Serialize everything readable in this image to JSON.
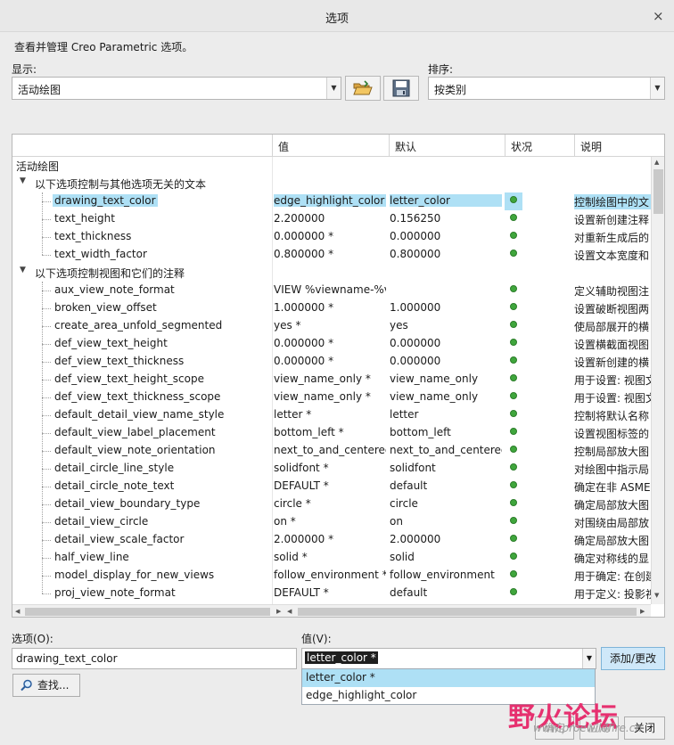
{
  "window": {
    "title": "选项",
    "close": "×"
  },
  "description": "查看并管理 Creo Parametric 选项。",
  "display": {
    "label": "显示:",
    "value": "活动绘图"
  },
  "sort": {
    "label": "排序:",
    "value": "按类别"
  },
  "columns": [
    "值",
    "默认",
    "状况",
    "说明"
  ],
  "tree": {
    "root": "活动绘图",
    "groups": [
      {
        "label": "以下选项控制与其他选项无关的文本",
        "rows": [
          {
            "name": "drawing_text_color",
            "value": "edge_highlight_color",
            "default": "letter_color",
            "desc": "控制绘图中的文"
          },
          {
            "name": "text_height",
            "value": "2.200000",
            "default": "0.156250",
            "desc": "设置新创建注释"
          },
          {
            "name": "text_thickness",
            "value": "0.000000 *",
            "default": "0.000000",
            "desc": "对重新生成后的"
          },
          {
            "name": "text_width_factor",
            "value": "0.800000 *",
            "default": "0.800000",
            "desc": "设置文本宽度和"
          }
        ]
      },
      {
        "label": "以下选项控制视图和它们的注释",
        "rows": [
          {
            "name": "aux_view_note_format",
            "value": "VIEW %viewname-%vi",
            "default": "",
            "desc": "定义辅助视图注"
          },
          {
            "name": "broken_view_offset",
            "value": "1.000000 *",
            "default": "1.000000",
            "desc": "设置破断视图两"
          },
          {
            "name": "create_area_unfold_segmented",
            "value": "yes *",
            "default": "yes",
            "desc": "使局部展开的横"
          },
          {
            "name": "def_view_text_height",
            "value": "0.000000 *",
            "default": "0.000000",
            "desc": "设置横截面视图"
          },
          {
            "name": "def_view_text_thickness",
            "value": "0.000000 *",
            "default": "0.000000",
            "desc": "设置新创建的横"
          },
          {
            "name": "def_view_text_height_scope",
            "value": "view_name_only *",
            "default": "view_name_only",
            "desc": "用于设置: 视图文"
          },
          {
            "name": "def_view_text_thickness_scope",
            "value": "view_name_only *",
            "default": "view_name_only",
            "desc": "用于设置: 视图文"
          },
          {
            "name": "default_detail_view_name_style",
            "value": "letter *",
            "default": "letter",
            "desc": "控制将默认名称"
          },
          {
            "name": "default_view_label_placement",
            "value": "bottom_left *",
            "default": "bottom_left",
            "desc": "设置视图标签的"
          },
          {
            "name": "default_view_note_orientation",
            "value": "next_to_and_centered",
            "default": "next_to_and_centered",
            "desc": "控制局部放大图"
          },
          {
            "name": "detail_circle_line_style",
            "value": "solidfont *",
            "default": "solidfont",
            "desc": "对绘图中指示局"
          },
          {
            "name": "detail_circle_note_text",
            "value": "DEFAULT *",
            "default": "default",
            "desc": "确定在非 ASME"
          },
          {
            "name": "detail_view_boundary_type",
            "value": "circle *",
            "default": "circle",
            "desc": "确定局部放大图"
          },
          {
            "name": "detail_view_circle",
            "value": "on *",
            "default": "on",
            "desc": "对围绕由局部放"
          },
          {
            "name": "detail_view_scale_factor",
            "value": "2.000000 *",
            "default": "2.000000",
            "desc": "确定局部放大图"
          },
          {
            "name": "half_view_line",
            "value": "solid *",
            "default": "solid",
            "desc": "确定对称线的显"
          },
          {
            "name": "model_display_for_new_views",
            "value": "follow_environment *",
            "default": "follow_environment",
            "desc": "用于确定: 在创建"
          },
          {
            "name": "proj_view_note_format",
            "value": "DEFAULT *",
            "default": "default",
            "desc": "用于定义: 投影视"
          }
        ]
      }
    ]
  },
  "option_field": {
    "label": "选项(O):",
    "value": "drawing_text_color"
  },
  "value_field": {
    "label": "值(V):",
    "value": "letter_color *",
    "options": [
      "letter_color *",
      "edge_highlight_color"
    ]
  },
  "buttons": {
    "add_change": "添加/更改",
    "find": "查找...",
    "ok": "确定",
    "apply": "应用",
    "close": "关闭"
  },
  "watermark": {
    "text": "野火论坛",
    "url": "www.proewildfire.cn"
  },
  "colors": {
    "highlight": "#aee0f5",
    "status_green": "#3fa63c",
    "watermark": "#e6306f"
  }
}
